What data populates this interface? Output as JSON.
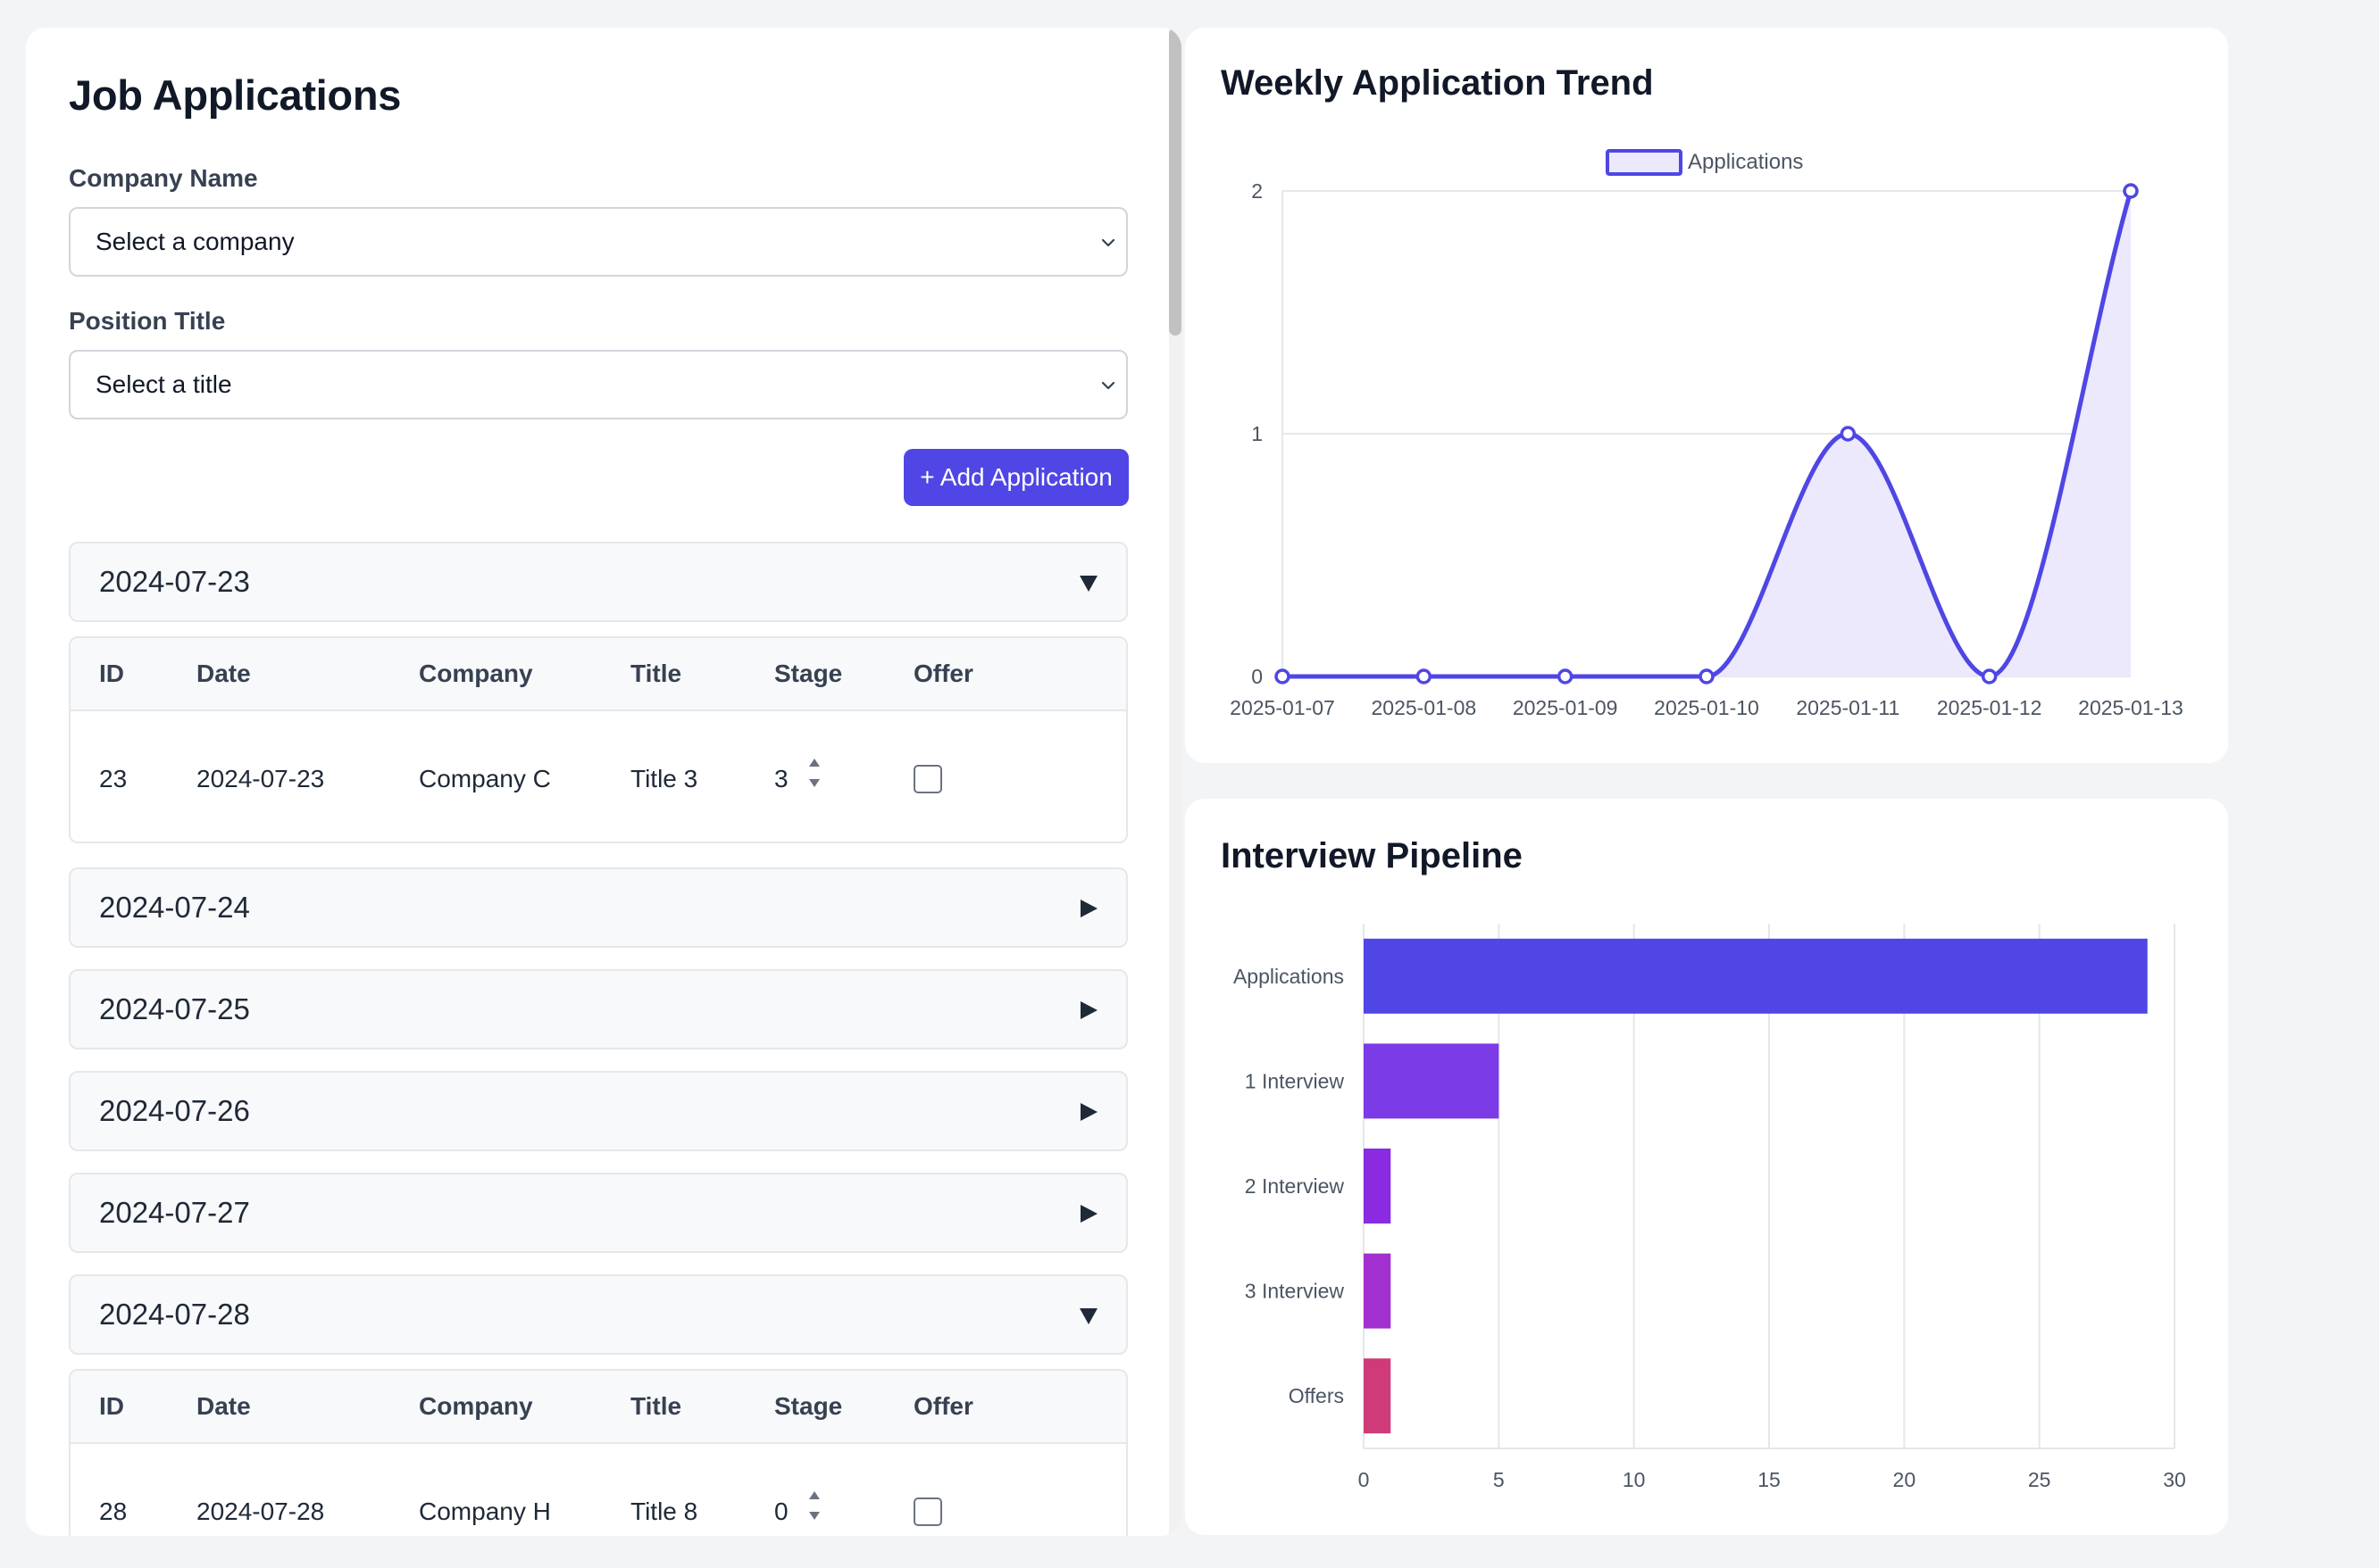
{
  "page": {
    "title": "Job Applications"
  },
  "filters": {
    "company_label": "Company Name",
    "company_value": "Select a company",
    "title_label": "Position Title",
    "title_value": "Select a title",
    "add_button": "+ Add Application"
  },
  "table_headers": [
    "ID",
    "Date",
    "Company",
    "Title",
    "Stage",
    "Offer"
  ],
  "groups": [
    {
      "date": "2024-07-23",
      "expanded": true,
      "rows": [
        {
          "id": "23",
          "date": "2024-07-23",
          "company": "Company C",
          "title": "Title 3",
          "stage": "3",
          "offer": false
        }
      ]
    },
    {
      "date": "2024-07-24",
      "expanded": false,
      "rows": []
    },
    {
      "date": "2024-07-25",
      "expanded": false,
      "rows": []
    },
    {
      "date": "2024-07-26",
      "expanded": false,
      "rows": []
    },
    {
      "date": "2024-07-27",
      "expanded": false,
      "rows": []
    },
    {
      "date": "2024-07-28",
      "expanded": true,
      "rows": [
        {
          "id": "28",
          "date": "2024-07-28",
          "company": "Company H",
          "title": "Title 8",
          "stage": "0",
          "offer": false
        }
      ]
    }
  ],
  "icons": {
    "expanded": "triangle-down-icon",
    "collapsed": "triangle-right-icon",
    "select": "chevron-down-icon",
    "stepper": "stepper-arrows-icon"
  },
  "colors": {
    "accent": "#4f46e5",
    "line_fill": "#ebe9fb",
    "bars": [
      "#4f46e5",
      "#7b3be6",
      "#8a2be2",
      "#a22fd0",
      "#cf3a78"
    ]
  },
  "trend_card": {
    "title": "Weekly Application Trend"
  },
  "pipeline_card": {
    "title": "Interview Pipeline"
  },
  "chart_data": [
    {
      "type": "line",
      "title": "Weekly Application Trend",
      "x": [
        "2025-01-07",
        "2025-01-08",
        "2025-01-09",
        "2025-01-10",
        "2025-01-11",
        "2025-01-12",
        "2025-01-13"
      ],
      "series": [
        {
          "name": "Applications",
          "values": [
            0,
            0,
            0,
            0,
            1,
            0,
            2
          ]
        }
      ],
      "ylim": [
        0,
        2
      ],
      "yticks": [
        0,
        1,
        2
      ],
      "area_fill": true,
      "smooth": true,
      "legend": "top-center",
      "grid": true
    },
    {
      "type": "bar",
      "orientation": "horizontal",
      "title": "Interview Pipeline",
      "categories": [
        "Applications",
        "1 Interview",
        "2 Interview",
        "3 Interview",
        "Offers"
      ],
      "values": [
        29,
        5,
        1,
        1,
        1
      ],
      "xlim": [
        0,
        30
      ],
      "xticks": [
        0,
        5,
        10,
        15,
        20,
        25,
        30
      ],
      "grid": true
    }
  ]
}
